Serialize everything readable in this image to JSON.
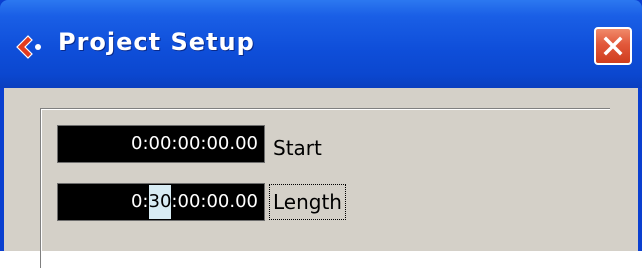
{
  "window": {
    "title": "Project Setup",
    "app_icon": "cubase-logo-icon",
    "close_icon": "close-icon",
    "colors": {
      "titlebar": "#0b47cf",
      "client": "#d4d0c8",
      "field_bg": "#000000",
      "field_text": "#ffffff",
      "selection": "#d8ecf4",
      "close_button": "#e2583a"
    }
  },
  "fields": {
    "start": {
      "value": "0:00:00:00.00",
      "label": "Start"
    },
    "length": {
      "value_prefix": "0:",
      "value_selected": "30",
      "value_suffix": ":00:00.00",
      "label": "Length"
    }
  }
}
